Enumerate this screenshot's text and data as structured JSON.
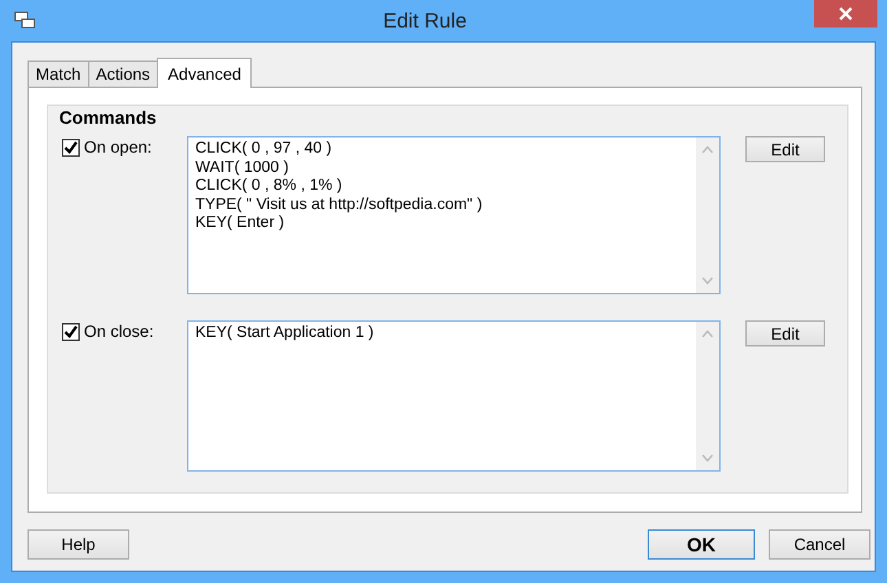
{
  "window": {
    "title": "Edit Rule"
  },
  "tabs": [
    {
      "label": "Match",
      "selected": false
    },
    {
      "label": "Actions",
      "selected": false
    },
    {
      "label": "Advanced",
      "selected": true
    }
  ],
  "group": {
    "title": "Commands",
    "commands": [
      {
        "label": "On open:",
        "checked": true,
        "lines": [
          "CLICK( 0 , 97 , 40 )",
          "WAIT( 1000 )",
          "CLICK( 0 , 8% , 1% )",
          "TYPE( \" Visit us at http://softpedia.com\" )",
          "KEY( Enter )"
        ],
        "button": "Edit"
      },
      {
        "label": "On close:",
        "checked": true,
        "lines": [
          "KEY( Start Application 1 )"
        ],
        "button": "Edit"
      }
    ]
  },
  "buttons": [
    {
      "label": "Help",
      "default": false
    },
    {
      "label": "OK",
      "default": true
    },
    {
      "label": "Cancel",
      "default": false
    }
  ]
}
